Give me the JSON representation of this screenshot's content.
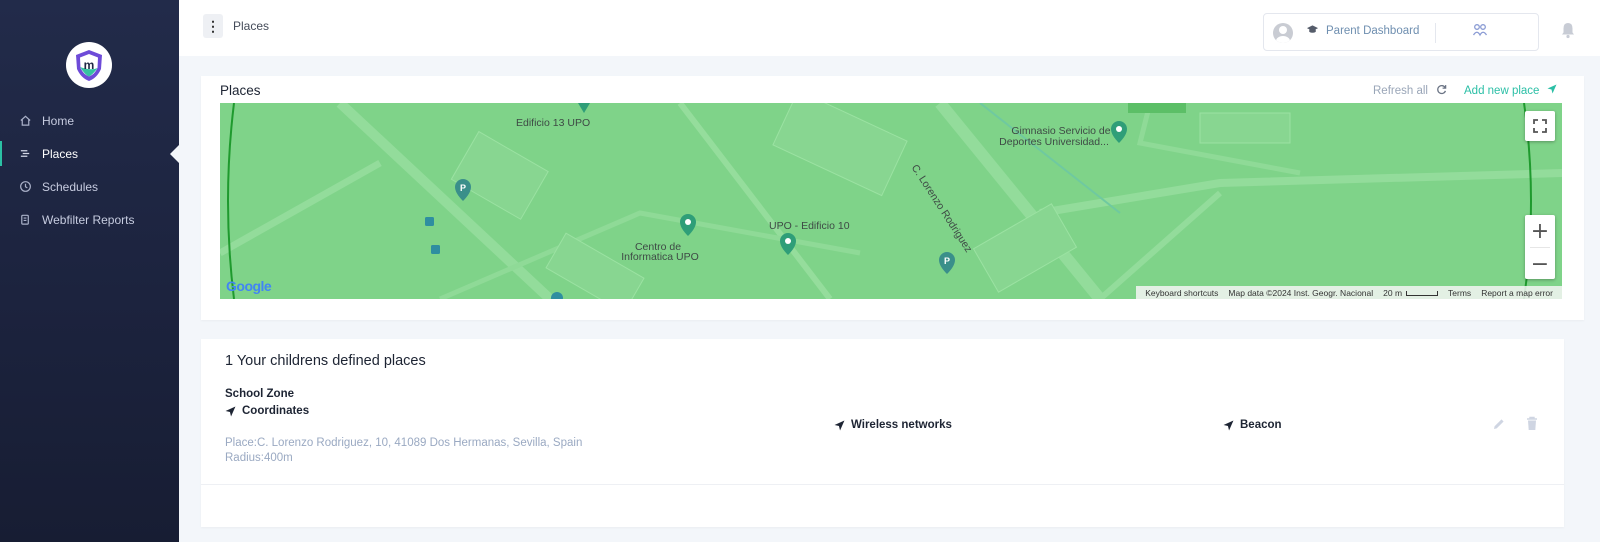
{
  "sidebar": {
    "logo_icon": "brand-shield-logo",
    "items": [
      {
        "label": "Home",
        "icon": "home-icon",
        "active": false
      },
      {
        "label": "Places",
        "icon": "places-icon",
        "active": true
      },
      {
        "label": "Schedules",
        "icon": "clock-icon",
        "active": false
      },
      {
        "label": "Webfilter Reports",
        "icon": "report-icon",
        "active": false
      }
    ]
  },
  "header": {
    "title": "Places",
    "parent_dashboard_label": "Parent Dashboard",
    "icons": [
      "menu-icon",
      "avatar-icon",
      "graduation-cap-icon",
      "children-icon",
      "bell-icon"
    ]
  },
  "map_card": {
    "title": "Places",
    "refresh_label": "Refresh all",
    "add_label": "Add new place",
    "map": {
      "labels": [
        "Edificio 13 UPO",
        "C. Lorenzo Rodriguez",
        "Gimnasio Servicio de",
        "Deportes Universidad...",
        "UPO - Edificio 10",
        "Centro de",
        "Informatica UPO"
      ],
      "logo": "Google",
      "attribution": {
        "shortcuts": "Keyboard shortcuts",
        "data": "Map data ©2024 Inst. Geogr. Nacional",
        "scale": "20 m",
        "terms": "Terms",
        "report": "Report a map error"
      },
      "colors": {
        "zone_fill": "#7fd389",
        "zone_border": "#1f9a2e"
      }
    }
  },
  "places": {
    "heading": "1 Your childrens defined places",
    "items": [
      {
        "name": "School Zone",
        "coordinates_label": "Coordinates",
        "address": "Place:C. Lorenzo Rodriguez, 10, 41089 Dos Hermanas, Sevilla, Spain",
        "radius": "Radius:400m",
        "wireless_label": "Wireless networks",
        "beacon_label": "Beacon"
      }
    ]
  },
  "colors": {
    "accent": "#2bbfa6",
    "sidebar_bg": "#1f2744",
    "muted_text": "#9aa9c2"
  }
}
